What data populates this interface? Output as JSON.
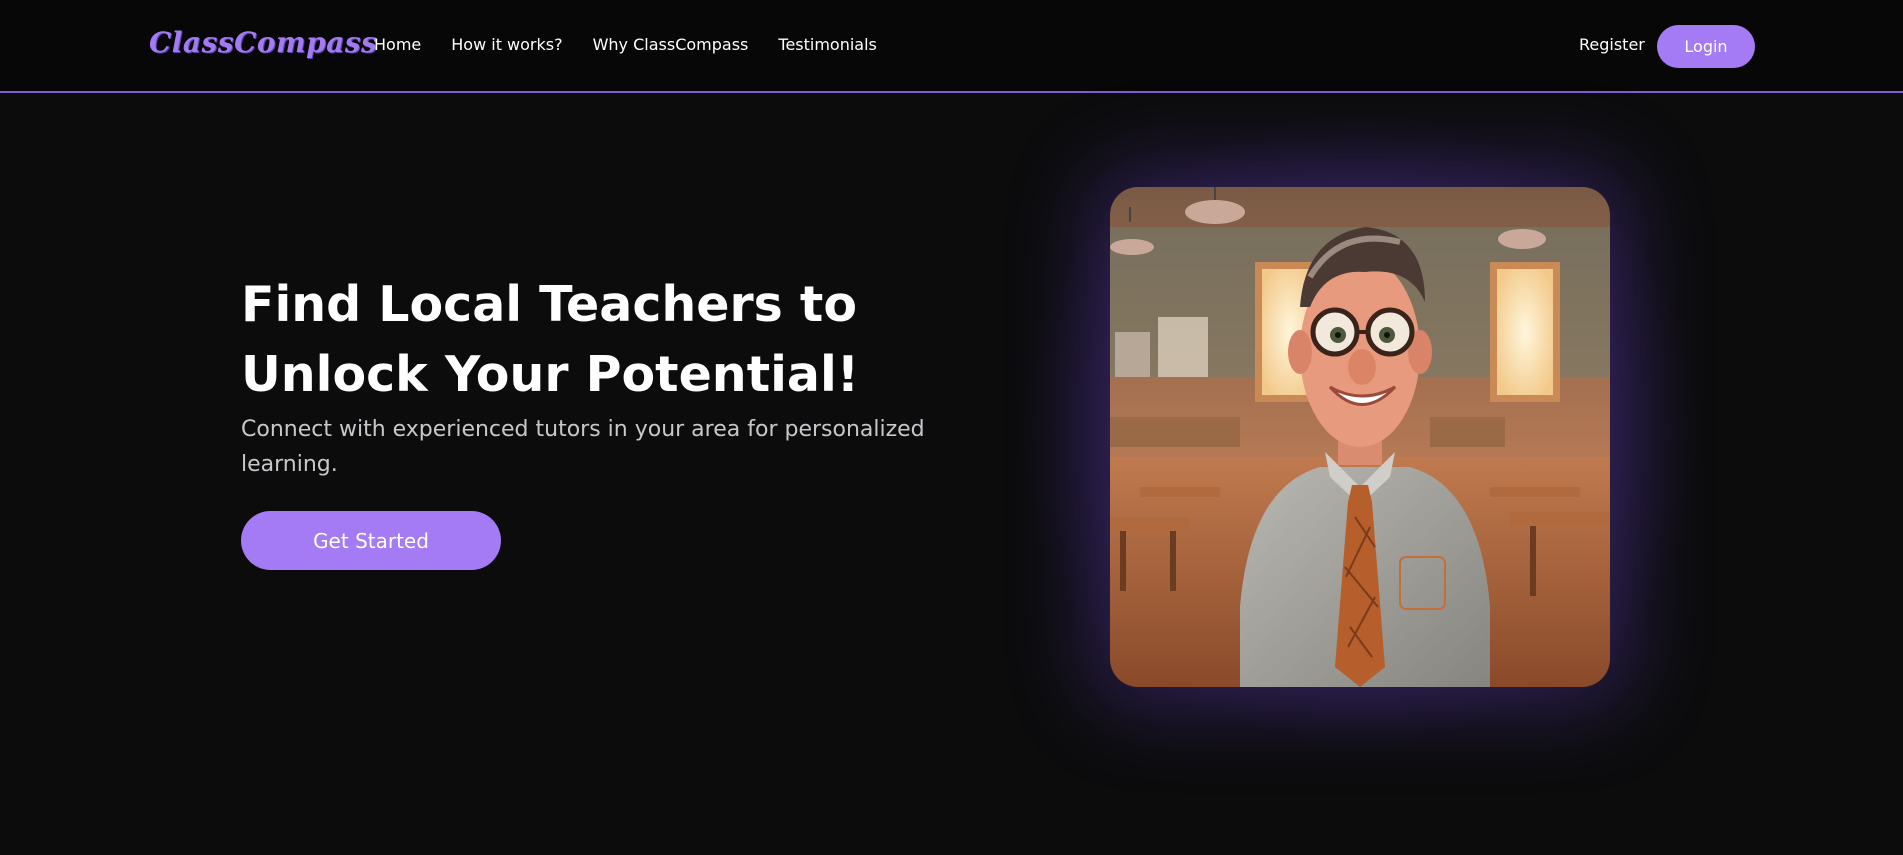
{
  "navbar": {
    "logo": "ClassCompass",
    "links": [
      "Home",
      "How it works?",
      "Why ClassCompass",
      "Testimonials"
    ],
    "register": "Register",
    "login": "Login"
  },
  "hero": {
    "title": "Find Local Teachers to Unlock Your Potential!",
    "subtitle": "Connect with experienced tutors in your area for personalized learning.",
    "cta": "Get Started"
  },
  "colors": {
    "accent": "#a47bf5",
    "background": "#0c0c0d",
    "navbar": "#070708"
  }
}
